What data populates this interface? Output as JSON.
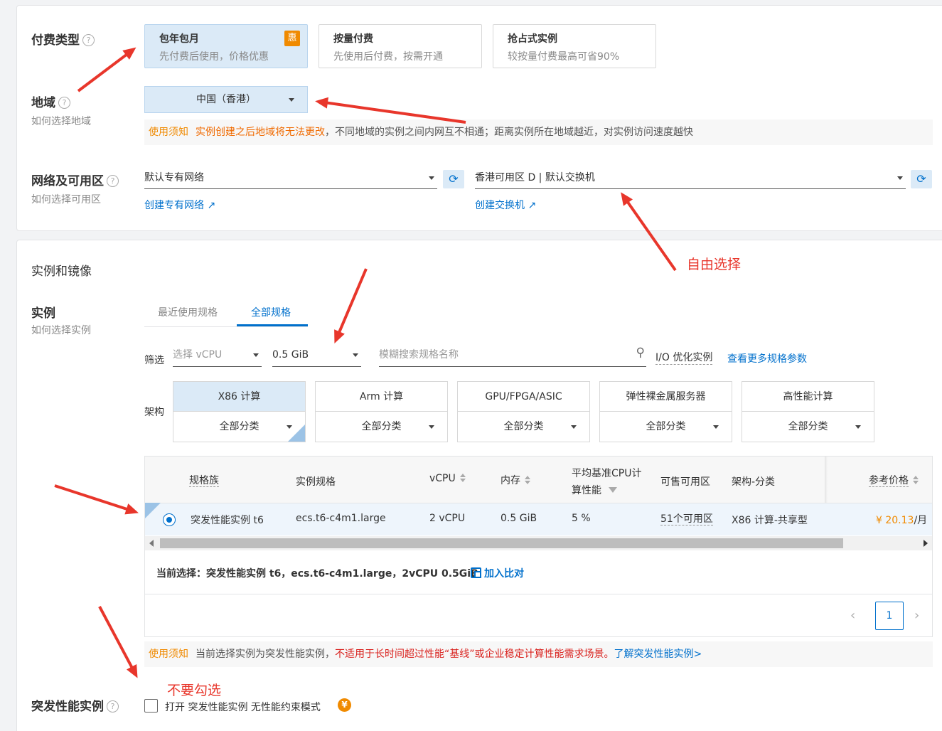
{
  "billing": {
    "label": "付费类型",
    "help": "?",
    "options": [
      {
        "title": "包年包月",
        "desc": "先付费后使用，价格优惠",
        "badge": "惠",
        "selected": true
      },
      {
        "title": "按量付费",
        "desc": "先使用后付费，按需开通",
        "selected": false
      },
      {
        "title": "抢占式实例",
        "desc": "较按量付费最高可省90%",
        "selected": false
      }
    ]
  },
  "region": {
    "label": "地域",
    "help": "?",
    "sub": "如何选择地域",
    "value": "中国（香港）",
    "notice_tag": "使用须知",
    "notice_warn": "实例创建之后地域将无法更改",
    "notice_rest": "，不同地域的实例之间内网互不相通；距离实例所在地域越近，对实例访问速度越快"
  },
  "network": {
    "label": "网络及可用区",
    "help": "?",
    "sub": "如何选择可用区",
    "vpc_value": "默认专有网络",
    "vpc_link": "创建专有网络",
    "zone_value": "香港可用区 D | 默认交换机",
    "zone_link": "创建交换机"
  },
  "instance_section": {
    "title": "实例和镜像",
    "label": "实例",
    "sub": "如何选择实例",
    "tabs": [
      {
        "label": "最近使用规格",
        "active": false
      },
      {
        "label": "全部规格",
        "active": true
      }
    ],
    "filter_label": "筛选",
    "vcpu_placeholder": "选择 vCPU",
    "mem_value": "0.5 GiB",
    "search_placeholder": "模糊搜索规格名称",
    "io_label": "I/O 优化实例",
    "more_link": "查看更多规格参数",
    "arch_label": "架构",
    "arch_cards": [
      {
        "title": "X86 计算",
        "sub": "全部分类",
        "selected": true
      },
      {
        "title": "Arm 计算",
        "sub": "全部分类",
        "selected": false
      },
      {
        "title": "GPU/FPGA/ASIC",
        "sub": "全部分类",
        "selected": false
      },
      {
        "title": "弹性裸金属服务器",
        "sub": "全部分类",
        "selected": false
      },
      {
        "title": "高性能计算",
        "sub": "全部分类",
        "selected": false
      }
    ]
  },
  "table": {
    "headers": {
      "family": "规格族",
      "spec": "实例规格",
      "vcpu": "vCPU",
      "mem": "内存",
      "cpu_base_1": "平均基准CPU计",
      "cpu_base_2": "算性能",
      "zones": "可售可用区",
      "arch": "架构-分类",
      "price": "参考价格"
    },
    "rows": [
      {
        "family": "突发性能实例 t6",
        "spec": "ecs.t6-c4m1.large",
        "vcpu": "2 vCPU",
        "mem": "0.5 GiB",
        "cpu_base": "5 %",
        "zones": "51个可用区",
        "arch": "X86 计算-共享型",
        "price": "¥ 20.13",
        "price_unit": "/月",
        "selected": true
      }
    ],
    "current_label": "当前选择：",
    "current_value": "突发性能实例 t6，ecs.t6-c4m1.large，2vCPU 0.5GiB",
    "compare_link": "加入比对",
    "page": "1"
  },
  "burst_notice": {
    "tag": "使用须知",
    "text1": "当前选择实例为突发性能实例，",
    "warn": "不适用于长时间超过性能“基线”或企业稳定计算性能需求场景。",
    "link": "了解突发性能实例>"
  },
  "burst": {
    "label": "突发性能实例",
    "help": "?",
    "checkbox_label": "打开 突发性能实例 无性能约束模式",
    "coin": "¥"
  },
  "annotations": {
    "free_choice": "自由选择",
    "do_not_check": "不要勾选"
  },
  "colors": {
    "accent": "#0070cc",
    "selected_bg": "#dbeaf7",
    "warn_orange": "#f06a00",
    "annotation_red": "#e8362b"
  }
}
